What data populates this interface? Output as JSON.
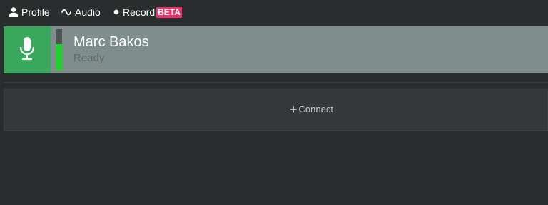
{
  "nav": {
    "profile": {
      "label": "Profile",
      "icon": "user-icon"
    },
    "audio": {
      "label": "Audio",
      "icon": "waveform-icon"
    },
    "record": {
      "label": "Record",
      "icon": "record-dot-icon",
      "badge": "BETA"
    }
  },
  "participant": {
    "name": "Marc Bakos",
    "status": "Ready",
    "icon": "microphone-icon",
    "audio_level": 0.64
  },
  "connect": {
    "label": "Connect",
    "icon": "plus-icon"
  },
  "colors": {
    "background": "#2a2d2e",
    "participant_row": "#7f8e8c",
    "mic_tile": "#3aa85c",
    "level_fill": "#20d12b",
    "beta_badge": "#e8336b"
  }
}
